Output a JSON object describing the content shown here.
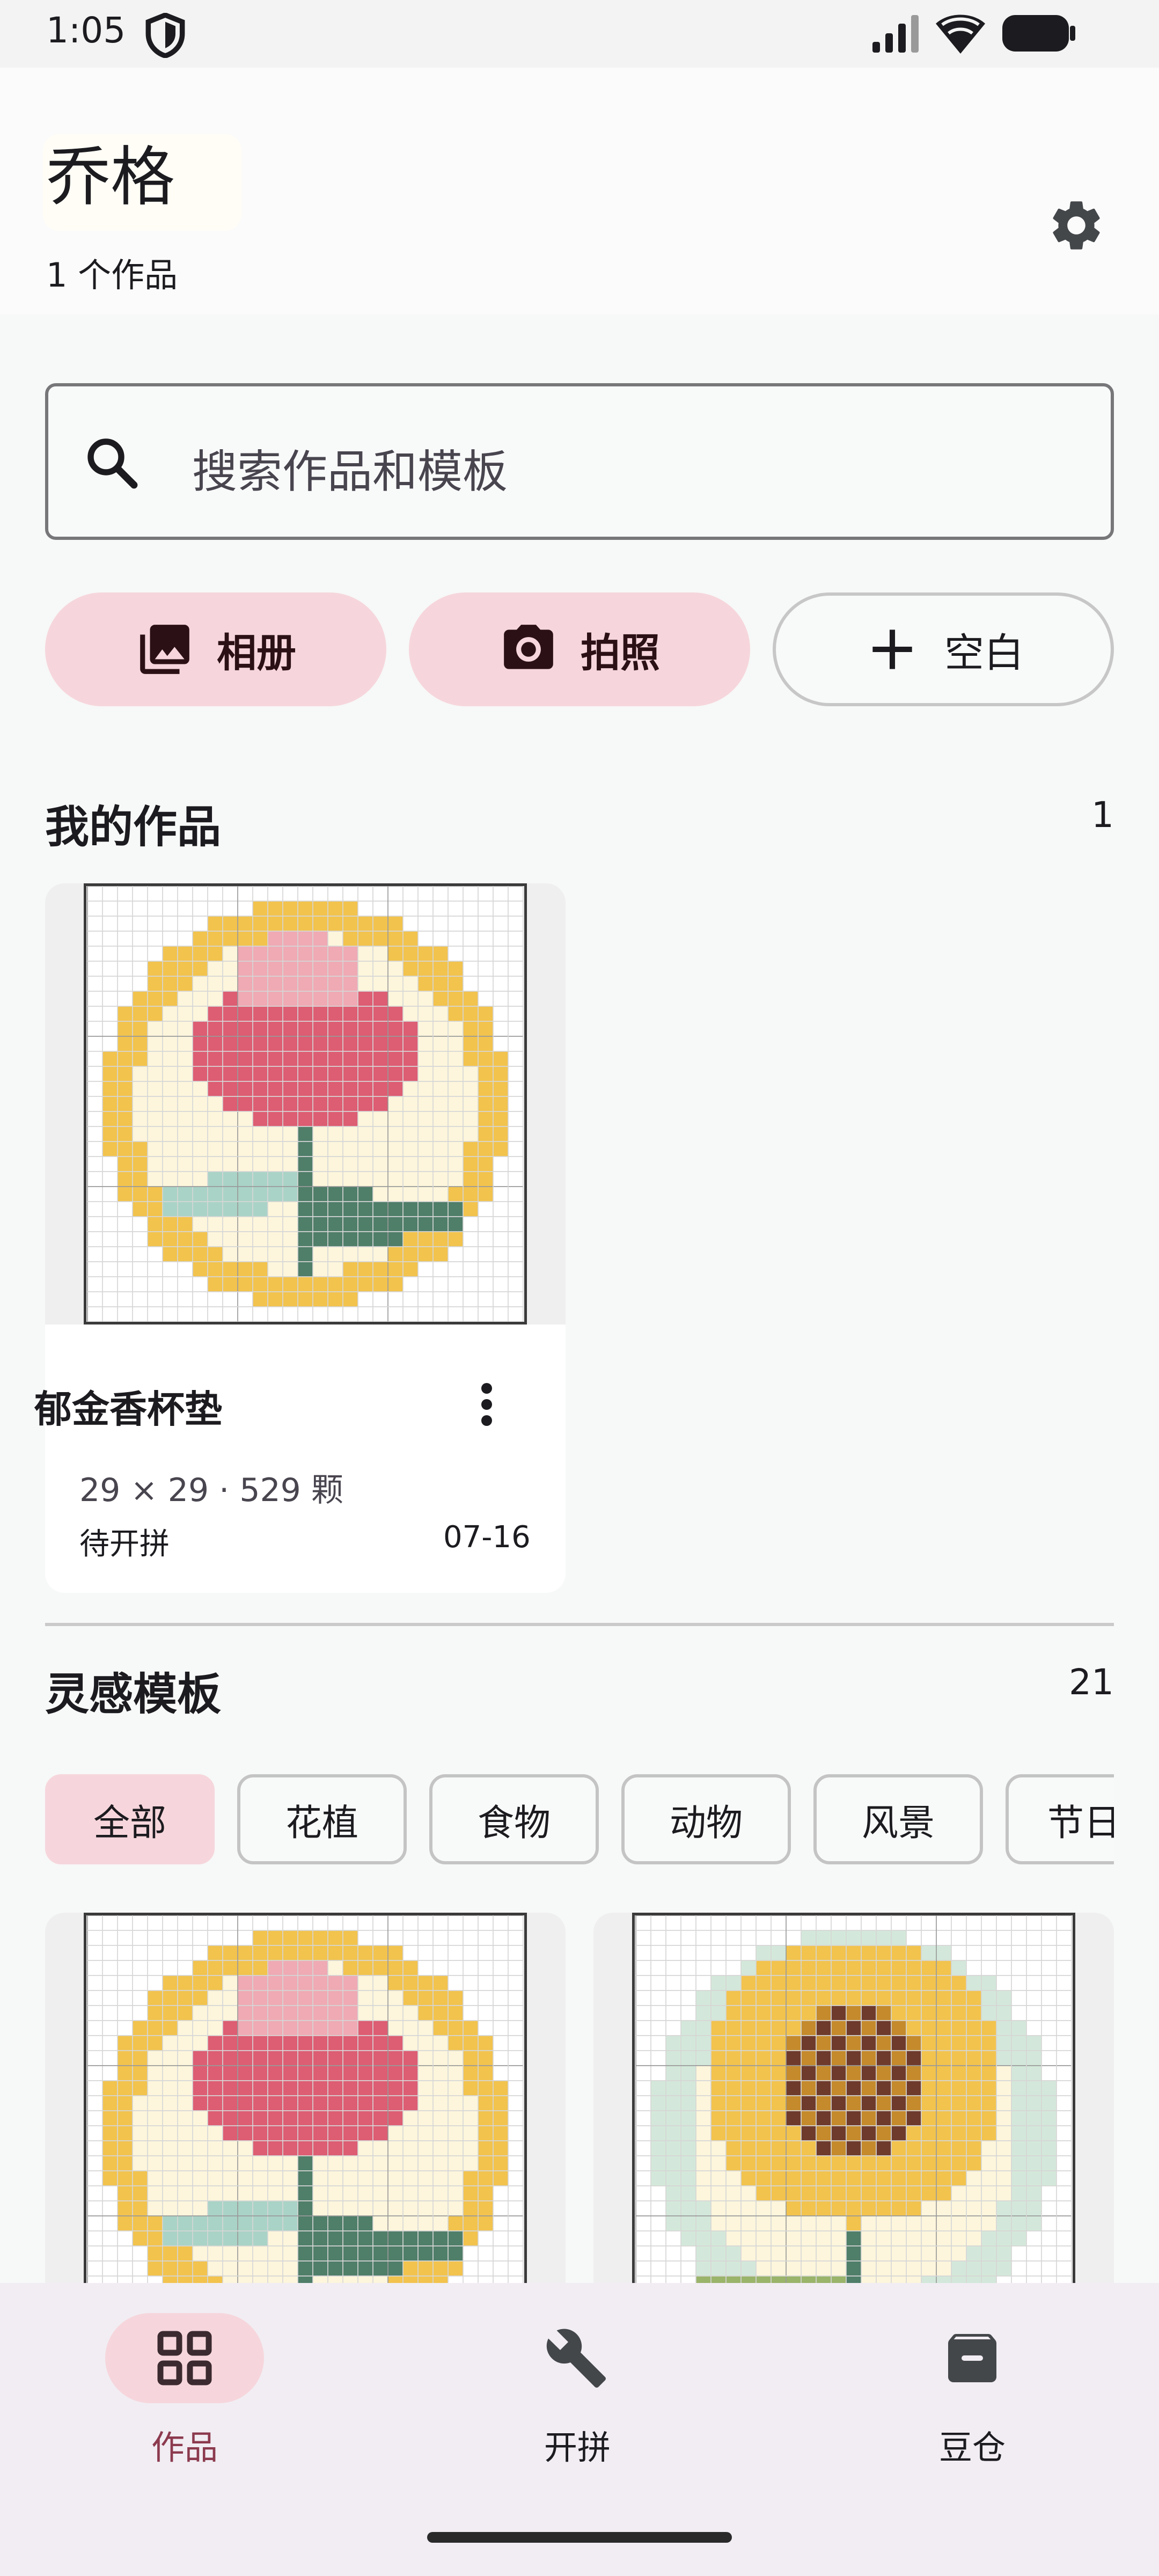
{
  "status_bar": {
    "time": "1:05"
  },
  "header": {
    "title": "乔格",
    "subtitle": "1 个作品"
  },
  "search": {
    "placeholder": "搜索作品和模板"
  },
  "actions": [
    {
      "label": "相册",
      "icon": "photo-library-icon"
    },
    {
      "label": "拍照",
      "icon": "camera-icon"
    },
    {
      "label": "空白",
      "icon": "plus-icon"
    }
  ],
  "my_works": {
    "title": "我的作品",
    "count": "1",
    "items": [
      {
        "name": "郁金香杯垫",
        "meta": "29 × 29 · 529 颗",
        "status": "待开拼",
        "date": "07-16"
      }
    ]
  },
  "templates": {
    "title": "灵感模板",
    "count": "21",
    "chips": [
      "全部",
      "花植",
      "食物",
      "动物",
      "风景",
      "节日"
    ],
    "selected_chip": "全部"
  },
  "bottom_nav": [
    {
      "label": "作品",
      "icon": "grid-icon",
      "active": true
    },
    {
      "label": "开拼",
      "icon": "wrench-icon",
      "active": false
    },
    {
      "label": "豆仓",
      "icon": "archive-icon",
      "active": false
    }
  ],
  "colors": {
    "accent_pink": "#f6d6dc",
    "active_nav_text": "#8c3a4e",
    "tulip_red": "#dd5d72",
    "tulip_light": "#efaab3",
    "border_yellow": "#f2c34d",
    "cream": "#fdf6dc",
    "leaf_light": "#a9d3c6",
    "leaf_dark": "#4f7e69",
    "sun_brown": "#6e3a2c"
  }
}
